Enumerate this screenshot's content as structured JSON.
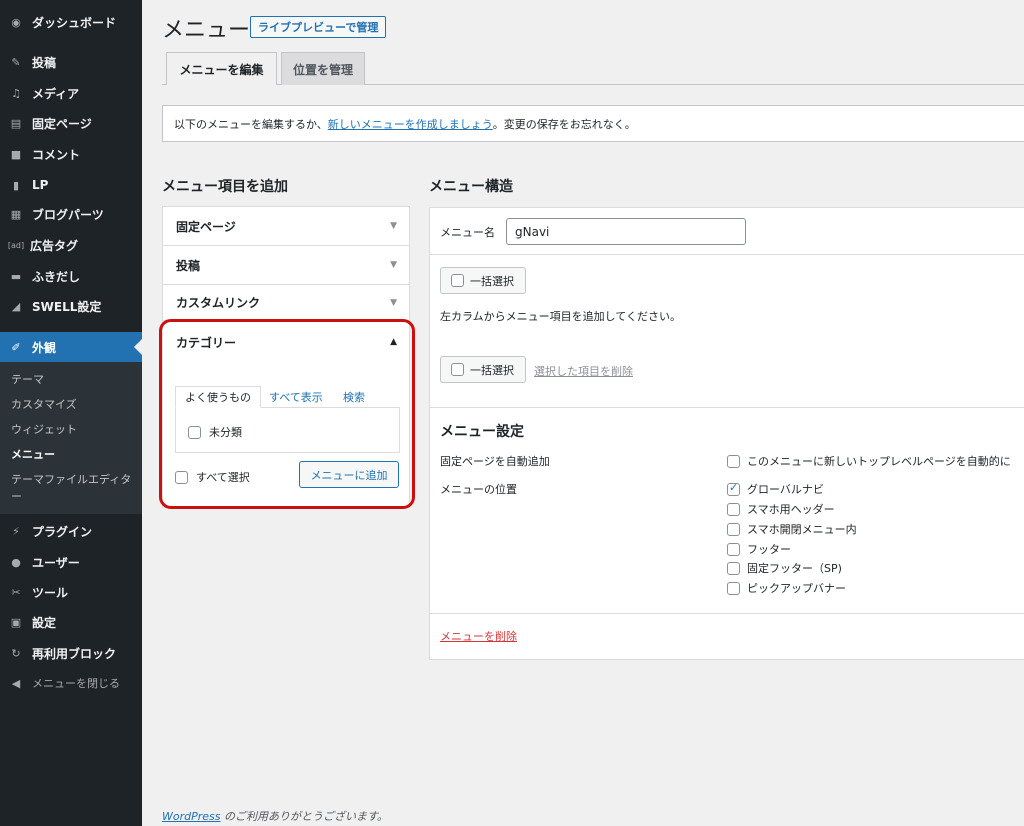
{
  "sidebar": {
    "items": [
      {
        "label": "ダッシュボード",
        "icon": "dashboard-icon"
      },
      {
        "label": "投稿",
        "icon": "pin-icon"
      },
      {
        "label": "メディア",
        "icon": "media-icon"
      },
      {
        "label": "固定ページ",
        "icon": "page-icon"
      },
      {
        "label": "コメント",
        "icon": "comment-icon"
      },
      {
        "label": "LP",
        "icon": "document-icon"
      },
      {
        "label": "ブログパーツ",
        "icon": "grid-icon"
      },
      {
        "label": "広告タグ",
        "icon_text": "[ad]"
      },
      {
        "label": "ふきだし",
        "icon": "speech-bubble-icon"
      },
      {
        "label": "SWELL設定",
        "icon": "swell-icon"
      },
      {
        "label": "外観",
        "icon": "paintbrush-icon"
      },
      {
        "label": "プラグイン",
        "icon": "plugin-icon"
      },
      {
        "label": "ユーザー",
        "icon": "user-icon"
      },
      {
        "label": "ツール",
        "icon": "wrench-icon"
      },
      {
        "label": "設定",
        "icon": "settings-icon"
      },
      {
        "label": "再利用ブロック",
        "icon": "reuse-icon"
      },
      {
        "label": "メニューを閉じる",
        "icon": "collapse-icon"
      }
    ],
    "submenu": [
      "テーマ",
      "カスタマイズ",
      "ウィジェット",
      "メニュー",
      "テーマファイルエディター"
    ]
  },
  "header": {
    "title": "メニュー",
    "live_preview": "ライブプレビューで管理"
  },
  "tabs": {
    "edit": "メニューを編集",
    "locations": "位置を管理"
  },
  "notice": {
    "before": "以下のメニューを編集するか、",
    "link": "新しいメニューを作成しましょう",
    "after": "。変更の保存をお忘れなく。"
  },
  "add_items": {
    "title": "メニュー項目を追加",
    "panels": [
      "固定ページ",
      "投稿",
      "カスタムリンク",
      "カテゴリー"
    ],
    "subtabs": {
      "most_used": "よく使うもの",
      "view_all": "すべて表示",
      "search": "検索"
    },
    "category_item": "未分類",
    "select_all": "すべて選択",
    "add_button": "メニューに追加"
  },
  "structure": {
    "title": "メニュー構造",
    "name_label": "メニュー名",
    "name_value": "gNavi",
    "bulk_select": "一括選択",
    "instructions": "左カラムからメニュー項目を追加してください。",
    "remove_selected": "選択した項目を削除",
    "settings_title": "メニュー設定",
    "auto_add_label": "固定ページを自動追加",
    "auto_add_option": "このメニューに新しいトップレベルページを自動的に",
    "location_label": "メニューの位置",
    "locations": [
      {
        "label": "グローバルナビ",
        "checked": true
      },
      {
        "label": "スマホ用ヘッダー",
        "checked": false
      },
      {
        "label": "スマホ開閉メニュー内",
        "checked": false
      },
      {
        "label": "フッター",
        "checked": false
      },
      {
        "label": "固定フッター（SP)",
        "checked": false
      },
      {
        "label": "ピックアップバナー",
        "checked": false
      }
    ],
    "delete_menu": "メニューを削除"
  },
  "footer": {
    "link": "WordPress",
    "text": " のご利用ありがとうございます。"
  }
}
